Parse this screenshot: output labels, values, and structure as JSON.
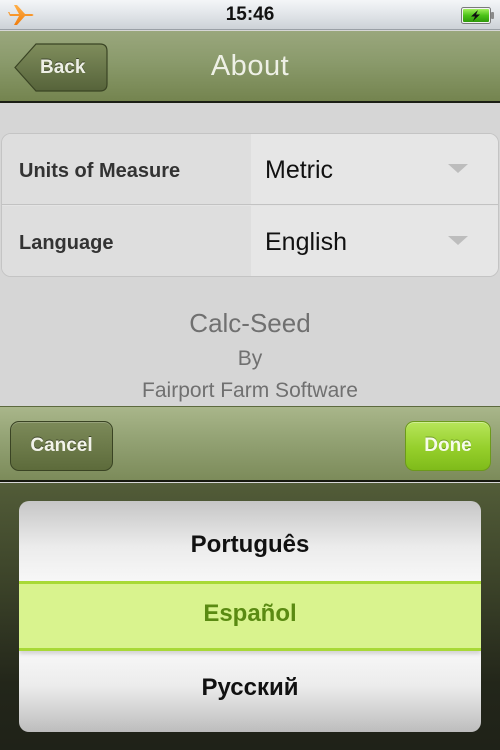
{
  "status_bar": {
    "time": "15:46",
    "left_icon": "airplane-mode-icon",
    "right_icon": "battery-charging-icon"
  },
  "nav_bar": {
    "back_label": "Back",
    "title": "About"
  },
  "settings": {
    "rows": [
      {
        "label": "Units of Measure",
        "value": "Metric",
        "icon": "dropdown-arrow-icon"
      },
      {
        "label": "Language",
        "value": "English",
        "icon": "dropdown-arrow-icon"
      }
    ]
  },
  "about": {
    "app_name": "Calc-Seed",
    "by": "By",
    "company": "Fairport Farm Software"
  },
  "picker_toolbar": {
    "cancel_label": "Cancel",
    "done_label": "Done"
  },
  "picker": {
    "options": [
      "Português",
      "Español",
      "Русский"
    ],
    "selected": "Español"
  },
  "colors": {
    "nav_green": "#8a9a6b",
    "done_green": "#95cf2b",
    "selection_fill": "#d9f38e",
    "selected_text": "#5a8a12",
    "airplane_orange": "#f7941d"
  }
}
